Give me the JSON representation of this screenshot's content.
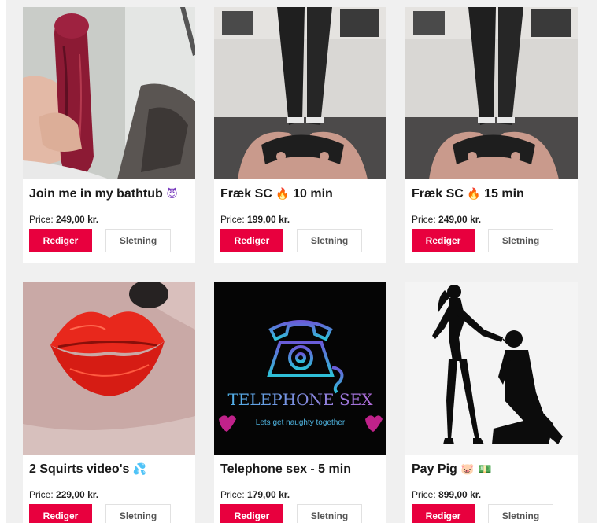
{
  "products": [
    {
      "title": "Join me in my bathtub",
      "emoji": "😈",
      "emoji_color": "#7b3fbf",
      "price_label": "Price:",
      "price": "249,00 kr.",
      "edit_label": "Rediger",
      "delete_label": "Sletning"
    },
    {
      "title": "Fræk SC",
      "emoji": "🔥",
      "emoji_color": "#f06a1a",
      "suffix": "10 min",
      "price_label": "Price:",
      "price": "199,00 kr.",
      "edit_label": "Rediger",
      "delete_label": "Sletning"
    },
    {
      "title": "Fræk SC",
      "emoji": "🔥",
      "emoji_color": "#f06a1a",
      "suffix": "15 min",
      "price_label": "Price:",
      "price": "249,00 kr.",
      "edit_label": "Rediger",
      "delete_label": "Sletning"
    },
    {
      "title": "2 Squirts video's",
      "emoji": "💦",
      "emoji_color": "#2aa0e0",
      "price_label": "Price:",
      "price": "229,00 kr.",
      "edit_label": "Rediger",
      "delete_label": "Sletning"
    },
    {
      "title": "Telephone sex - 5 min",
      "price_label": "Price:",
      "price": "179,00 kr.",
      "edit_label": "Rediger",
      "delete_label": "Sletning",
      "image_text": {
        "headline": "TELEPHONE SEX",
        "tagline": "Lets get naughty together"
      }
    },
    {
      "title": "Pay Pig",
      "emoji": "🐷",
      "emoji_color": "#f28ab0",
      "emoji2": "💵",
      "emoji2_color": "#3a9a3a",
      "price_label": "Price:",
      "price": "899,00 kr.",
      "edit_label": "Rediger",
      "delete_label": "Sletning"
    }
  ],
  "colors": {
    "accent": "#e8003e",
    "background": "#f0f0f0",
    "card": "#ffffff"
  }
}
